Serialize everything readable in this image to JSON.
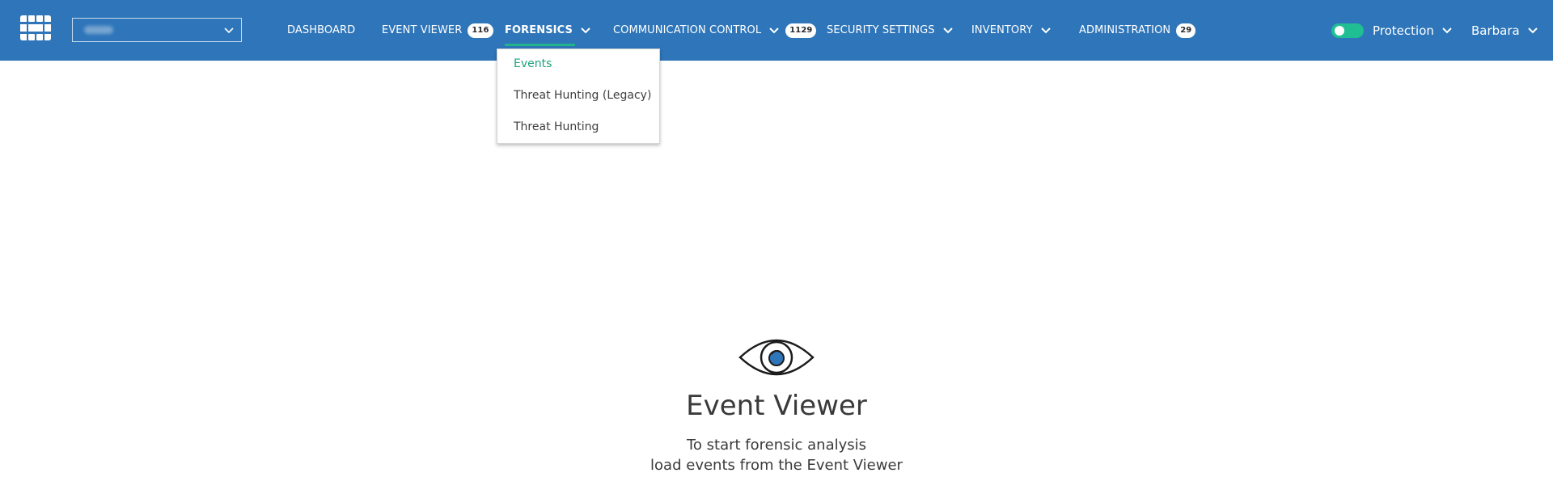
{
  "header": {
    "logo_icon": "fortinet-grid-logo-icon",
    "org_select_chevron_icon": "chevron-down-icon",
    "nav": [
      {
        "label": "DASHBOARD"
      },
      {
        "label": "EVENT VIEWER",
        "badge": "116"
      },
      {
        "label": "FORENSICS",
        "active": true,
        "icon": "chevron-down-icon"
      },
      {
        "label": "COMMUNICATION CONTROL",
        "icon": "chevron-down-icon",
        "badge": "1129"
      },
      {
        "label": "SECURITY SETTINGS",
        "icon": "chevron-down-icon"
      },
      {
        "label": "INVENTORY",
        "icon": "chevron-down-icon"
      },
      {
        "label": "ADMINISTRATION",
        "badge": "29"
      }
    ],
    "protection": {
      "label": "Protection",
      "enabled": true,
      "icon": "chevron-down-icon"
    },
    "user": {
      "name": "Barbara",
      "icon": "chevron-down-icon"
    }
  },
  "forensics_menu": {
    "items": [
      {
        "label": "Events",
        "selected": true
      },
      {
        "label": "Threat Hunting (Legacy)"
      },
      {
        "label": "Threat Hunting"
      }
    ]
  },
  "empty_state": {
    "icon": "eye-icon",
    "title": "Event Viewer",
    "line1": "To start forensic analysis",
    "line2": "load events from the Event Viewer"
  },
  "colors": {
    "topbar": "#2e75b9",
    "accent": "#21b38c",
    "toggle_on": "#1fbf93",
    "eye_pupil": "#2e75b9"
  }
}
